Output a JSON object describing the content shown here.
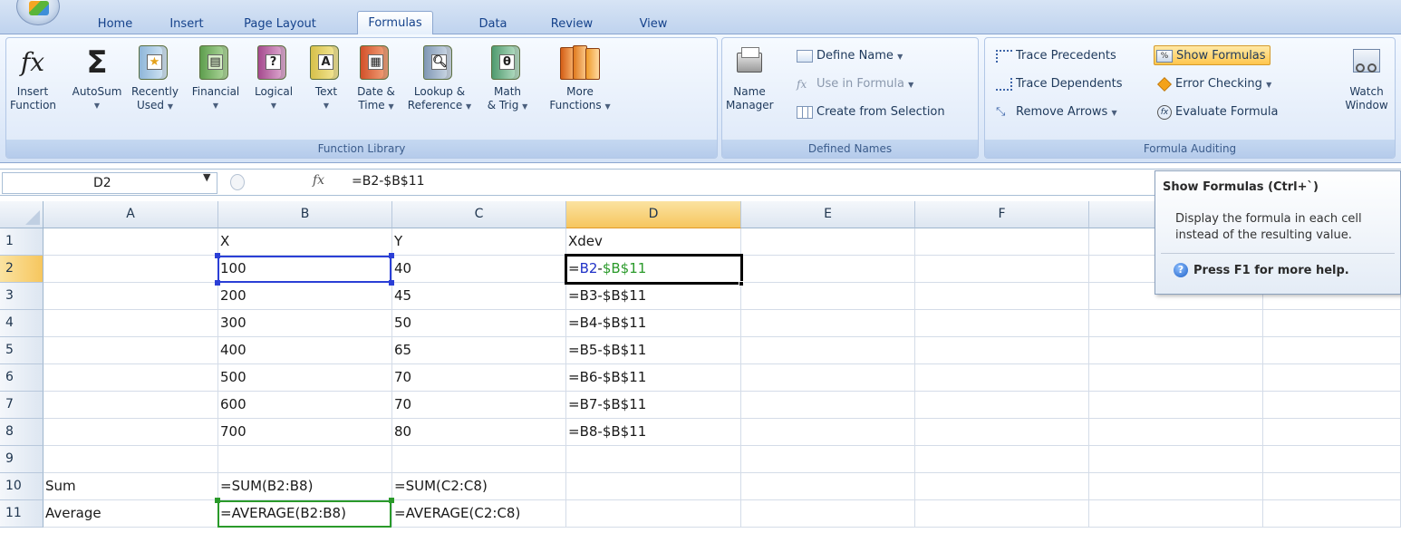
{
  "tabs": [
    "Home",
    "Insert",
    "Page Layout",
    "Formulas",
    "Data",
    "Review",
    "View"
  ],
  "active_tab": "Formulas",
  "ribbon": {
    "function_library": {
      "label": "Function Library",
      "insert_function": [
        "Insert",
        "Function"
      ],
      "autosum": "AutoSum",
      "recently_used": [
        "Recently",
        "Used"
      ],
      "financial": "Financial",
      "logical": "Logical",
      "text": "Text",
      "date_time": [
        "Date &",
        "Time"
      ],
      "lookup_reference": [
        "Lookup &",
        "Reference"
      ],
      "math_trig": [
        "Math",
        "& Trig"
      ],
      "more_functions": [
        "More",
        "Functions"
      ]
    },
    "defined_names": {
      "label": "Defined Names",
      "name_manager": [
        "Name",
        "Manager"
      ],
      "define_name": "Define Name",
      "use_in_formula": "Use in Formula",
      "create_from_selection": "Create from Selection"
    },
    "formula_auditing": {
      "label": "Formula Auditing",
      "trace_precedents": "Trace Precedents",
      "trace_dependents": "Trace Dependents",
      "remove_arrows": "Remove Arrows",
      "show_formulas": "Show Formulas",
      "error_checking": "Error Checking",
      "evaluate_formula": "Evaluate Formula",
      "watch_window": [
        "Watch",
        "Window"
      ]
    }
  },
  "formula_bar": {
    "name_box": "D2",
    "fx": "fx",
    "formula": "=B2-$B$11"
  },
  "columns": [
    "A",
    "B",
    "C",
    "D",
    "E",
    "F"
  ],
  "rows": [
    "1",
    "2",
    "3",
    "4",
    "5",
    "6",
    "7",
    "8",
    "9",
    "10",
    "11"
  ],
  "cells": {
    "B1": "X",
    "C1": "Y",
    "D1": "Xdev",
    "B2": "100",
    "C2": "40",
    "D2": "=B2-$B$11",
    "B3": "200",
    "C3": "45",
    "D3": "=B3-$B$11",
    "B4": "300",
    "C4": "50",
    "D4": "=B4-$B$11",
    "B5": "400",
    "C5": "65",
    "D5": "=B5-$B$11",
    "B6": "500",
    "C6": "70",
    "D6": "=B6-$B$11",
    "B7": "600",
    "C7": "70",
    "D7": "=B7-$B$11",
    "B8": "700",
    "C8": "80",
    "D8": "=B8-$B$11",
    "A10": "Sum",
    "B10": "=SUM(B2:B8)",
    "C10": "=SUM(C2:C8)",
    "A11": "Average",
    "B11": "=AVERAGE(B2:B8)",
    "C11": "=AVERAGE(C2:C8)"
  },
  "active_cell": "D2",
  "d2_parts": {
    "eq": "=",
    "ref1": "B2",
    "minus": "-",
    "ref2": "$B$11"
  },
  "tooltip": {
    "title": "Show Formulas (Ctrl+`)",
    "description": "Display the formula in each cell instead of the resulting value.",
    "help": "Press F1 for more help."
  },
  "colors": {
    "accent": "#f6c65e",
    "ref_blue": "#1f31c7",
    "ref_green": "#2a9a2a"
  }
}
